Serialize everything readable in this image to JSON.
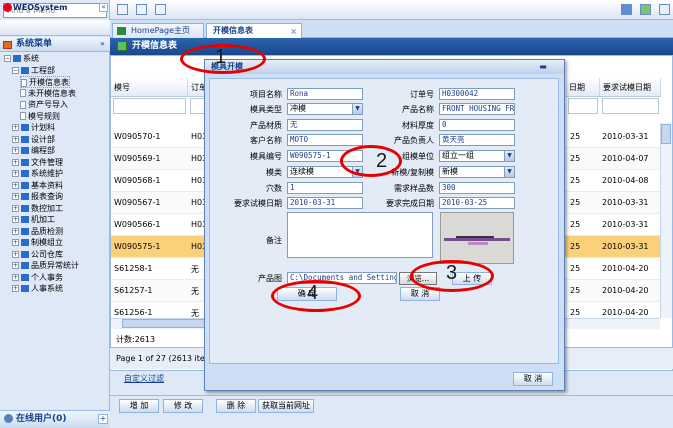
{
  "sidebar": {
    "search_placeholder": "Find a Menu",
    "logo": "WEOSystem",
    "menu_title": "系统菜单",
    "online_users": "在线用户(0)",
    "tree": [
      {
        "label": "系统",
        "level": 0
      },
      {
        "label": "工程部",
        "level": 1
      },
      {
        "label": "开模信息表",
        "level": 2,
        "selected": true
      },
      {
        "label": "未开模信息表",
        "level": 2
      },
      {
        "label": "资产号导入",
        "level": 2
      },
      {
        "label": "模号规则",
        "level": 2
      },
      {
        "label": "计划科",
        "level": 1
      },
      {
        "label": "设计部",
        "level": 1
      },
      {
        "label": "编程部",
        "level": 1
      },
      {
        "label": "文件管理",
        "level": 1
      },
      {
        "label": "系统维护",
        "level": 1
      },
      {
        "label": "基本资料",
        "level": 1
      },
      {
        "label": "报表查询",
        "level": 1
      },
      {
        "label": "数控加工",
        "level": 1
      },
      {
        "label": "机加工",
        "level": 1
      },
      {
        "label": "品质检测",
        "level": 1
      },
      {
        "label": "制模组立",
        "level": 1
      },
      {
        "label": "公司仓库",
        "level": 1
      },
      {
        "label": "品质异常统计",
        "level": 1
      },
      {
        "label": "个人事务",
        "level": 1
      },
      {
        "label": "人事系统",
        "level": 1
      }
    ]
  },
  "tabs": [
    {
      "label": "HomePage主页",
      "active": false
    },
    {
      "label": "开模信息表",
      "active": true
    }
  ],
  "panel_title": "开模信息表",
  "grid": {
    "col1": "模号",
    "col2": "订单",
    "col_date1_partial": "日期",
    "col_date2": "要求试模日期",
    "rows": [
      {
        "mold": "W090570-1",
        "order": "H03",
        "c3": "25",
        "date": "2010-03-31"
      },
      {
        "mold": "W090569-1",
        "order": "H03",
        "c3": "25",
        "date": "2010-04-07"
      },
      {
        "mold": "W090568-1",
        "order": "H03",
        "c3": "25",
        "date": "2010-04-08"
      },
      {
        "mold": "W090567-1",
        "order": "H03",
        "c3": "25",
        "date": "2010-03-31"
      },
      {
        "mold": "W090566-1",
        "order": "H03",
        "c3": "25",
        "date": "2010-03-31"
      },
      {
        "mold": "W090575-1",
        "order": "H03",
        "c3": "25",
        "date": "2010-03-31"
      },
      {
        "mold": "S61258-1",
        "order": "无",
        "c3": "25",
        "date": "2010-04-20"
      },
      {
        "mold": "S61257-1",
        "order": "无",
        "c3": "25",
        "date": "2010-04-20"
      },
      {
        "mold": "S61256-1",
        "order": "无",
        "c3": "25",
        "date": "2010-04-20"
      }
    ],
    "count_text": "计数:2613",
    "pager_text": "Page 1 of 27 (2613 iter",
    "filter_text": "自定义过滤"
  },
  "bottom_buttons": [
    "增 加",
    "修 改",
    "删 除",
    "获取当前网址"
  ],
  "dialog": {
    "title": "模具开模",
    "fields": {
      "project_name_label": "项目名称",
      "project_name": "Rona",
      "order_no_label": "订单号",
      "order_no": "H0300042",
      "mold_type_label": "模具类型",
      "mold_type": "冲模",
      "product_name_label": "产品名称",
      "product_name": "FRONT HOUSING FR",
      "product_material_label": "产品材质",
      "product_material": "无",
      "material_thickness_label": "材料厚度",
      "material_thickness": "0",
      "customer_name_label": "客户名称",
      "customer_name": "MOTO",
      "product_owner_label": "产品负责人",
      "product_owner": "黄天亮",
      "mold_no_label": "模具编号",
      "mold_no": "W090575-1",
      "assembly_unit_label": "组模单位",
      "assembly_unit": "组立一组",
      "mold_kind_label": "模类",
      "mold_kind": "连续模",
      "new_copy_label": "新模/复制模",
      "new_copy": "新模",
      "cavities_label": "穴数",
      "cavities": "1",
      "sample_qty_label": "需求样品数",
      "sample_qty": "300",
      "trial_date_label": "要求试模日期",
      "trial_date": "2010-03-31",
      "complete_date_label": "要求完成日期",
      "complete_date": "2010-03-25",
      "remark_label": "备注",
      "product_image_label": "产品图",
      "file_path": "C:\\Documents and Setting",
      "browse_label": "浏览...",
      "upload_label": "上 传",
      "confirm_label": "确 定",
      "cancel_inner_label": "取 消"
    },
    "cancel_label": "取 消"
  },
  "annotations": [
    "1",
    "2",
    "3",
    "4"
  ]
}
